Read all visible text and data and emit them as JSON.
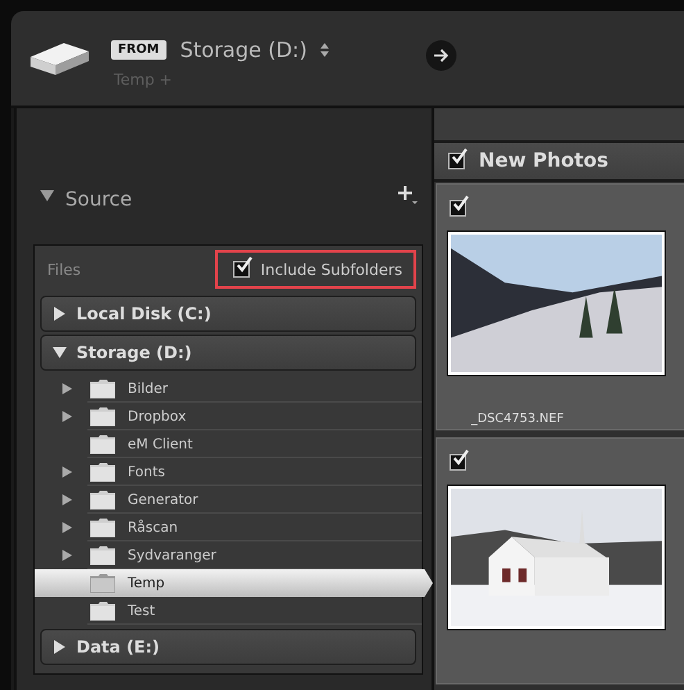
{
  "header": {
    "from_label": "FROM",
    "source": "Storage (D:)",
    "path": "Temp +"
  },
  "source_panel": {
    "title": "Source",
    "expanded": true,
    "files_label": "Files",
    "include_subfolders": {
      "label": "Include Subfolders",
      "checked": true,
      "highlighted": true
    },
    "drives": [
      {
        "name": "Local Disk (C:)",
        "expanded": false
      },
      {
        "name": "Storage (D:)",
        "expanded": true,
        "folders": [
          {
            "name": "Bilder",
            "has_children": true,
            "selected": false
          },
          {
            "name": "Dropbox",
            "has_children": true,
            "selected": false
          },
          {
            "name": "eM Client",
            "has_children": false,
            "selected": false
          },
          {
            "name": "Fonts",
            "has_children": true,
            "selected": false
          },
          {
            "name": "Generator",
            "has_children": true,
            "selected": false
          },
          {
            "name": "Råscan",
            "has_children": true,
            "selected": false
          },
          {
            "name": "Sydvaranger",
            "has_children": true,
            "selected": false
          },
          {
            "name": "Temp",
            "has_children": false,
            "selected": true
          },
          {
            "name": "Test",
            "has_children": false,
            "selected": false
          }
        ]
      },
      {
        "name": "Data (E:)",
        "expanded": false
      }
    ]
  },
  "photos": {
    "group": {
      "title": "New Photos",
      "checked": true
    },
    "items": [
      {
        "kind": "landscape",
        "filename": "_DSC4753.NEF",
        "checked": true
      },
      {
        "kind": "church",
        "checked": true
      }
    ]
  }
}
